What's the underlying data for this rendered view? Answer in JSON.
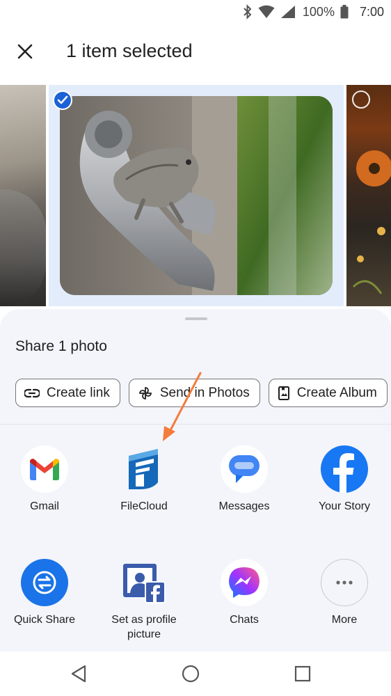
{
  "status_bar": {
    "battery_percent": "100%",
    "time": "7:00",
    "icons": [
      "bluetooth-icon",
      "wifi-icon",
      "signal-icon",
      "battery-icon"
    ]
  },
  "header": {
    "close_icon": "close-icon",
    "title": "1 item selected"
  },
  "photo_strip": {
    "photos": [
      {
        "selected": false
      },
      {
        "selected": true
      },
      {
        "selected": false
      }
    ]
  },
  "share_sheet": {
    "title": "Share 1 photo",
    "actions": [
      {
        "icon": "link-icon",
        "label": "Create link"
      },
      {
        "icon": "pinwheel-icon",
        "label": "Send in Photos"
      },
      {
        "icon": "album-icon",
        "label": "Create Album"
      }
    ],
    "apps": [
      {
        "icon": "gmail-icon",
        "label": "Gmail"
      },
      {
        "icon": "filecloud-icon",
        "label": "FileCloud"
      },
      {
        "icon": "messages-icon",
        "label": "Messages"
      },
      {
        "icon": "facebook-icon",
        "label": "Your Story"
      },
      {
        "icon": "quick-share-icon",
        "label": "Quick Share"
      },
      {
        "icon": "profile-picture-icon",
        "label": "Set as profile picture"
      },
      {
        "icon": "messenger-icon",
        "label": "Chats"
      },
      {
        "icon": "more-icon",
        "label": "More"
      }
    ]
  },
  "nav_bar": {
    "icons": [
      "back-icon",
      "home-icon",
      "recents-icon"
    ]
  },
  "colors": {
    "accent_blue": "#1a62d6",
    "sheet_background": "#f3f5fb",
    "selected_photo_background": "#e3ecfb",
    "annotation_arrow": "#f47c3c"
  }
}
